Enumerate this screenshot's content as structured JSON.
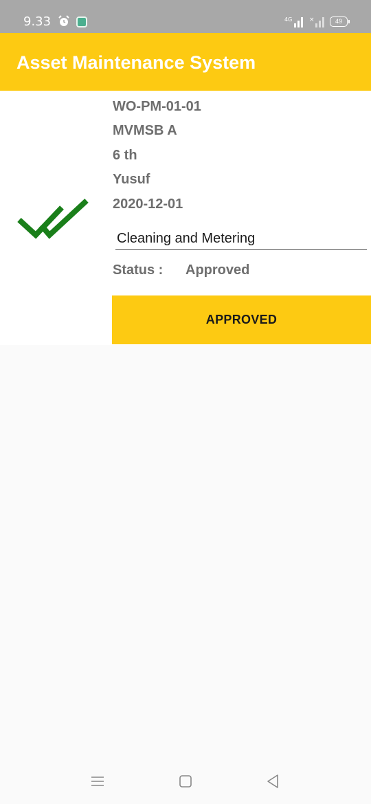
{
  "status_bar": {
    "time": "9.33",
    "battery": "49",
    "icons": [
      "alarm-icon",
      "app-notification-icon",
      "signal-4g-icon",
      "signal-no-sim-icon",
      "battery-icon"
    ]
  },
  "app_bar": {
    "title": "Asset Maintenance System",
    "color": "#fdca12"
  },
  "work_order": {
    "id": "WO-PM-01-01",
    "site": "MVMSB A",
    "floor": "6 th",
    "technician": "Yusuf",
    "date": "2020-12-01",
    "task": "Cleaning and Metering",
    "status_label": "Status :",
    "status_value": "Approved",
    "status_icon": "double-check-icon",
    "status_icon_color": "#1a7f1a",
    "action_label": "APPROVED"
  },
  "nav_bar": {
    "icons": [
      "menu-icon",
      "home-icon",
      "back-icon"
    ]
  }
}
